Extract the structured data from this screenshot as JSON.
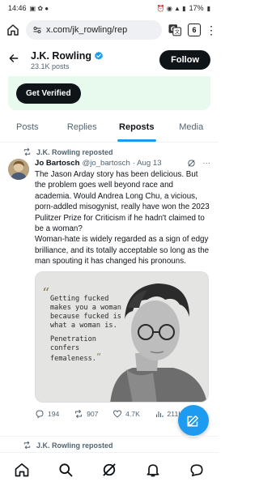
{
  "status_bar": {
    "time": "14:46",
    "battery": "17%"
  },
  "browser": {
    "url": "x.com/jk_rowling/rep",
    "tab_count": "6"
  },
  "profile": {
    "name": "J.K. Rowling",
    "post_count": "23.1K posts",
    "follow_label": "Follow",
    "get_verified_label": "Get Verified"
  },
  "tabs": [
    {
      "label": "Posts"
    },
    {
      "label": "Replies"
    },
    {
      "label": "Reposts"
    },
    {
      "label": "Media"
    }
  ],
  "active_tab": "Reposts",
  "tweet": {
    "repost_label": "J.K. Rowling reposted",
    "author": "Jo Bartosch",
    "handle": "@jo_bartosch",
    "date": "· Aug 13",
    "text": "The Jason Arday story has been delicious. But the problem goes well beyond race and academia. Would Andrea Long Chu, a vicious, porn-addled misogynist, really have won the 2023 Pulitzer Prize for Criticism if he hadn't claimed to be a woman?\nWoman-hate is widely regarded as a sign of edgy brilliance, and its totally acceptable so long as the man spouting it has changed his pronouns.",
    "media_quote": {
      "part1": "Getting fucked makes you a woman because fucked is what a woman is.",
      "part2": "Penetration confers femaleness."
    },
    "stats": {
      "replies": "194",
      "reposts": "907",
      "likes": "4.7K",
      "views": "211K"
    }
  },
  "next_repost_label": "J.K. Rowling reposted",
  "colors": {
    "accent": "#1d9bf0",
    "verified_banner_bg": "#e8f9ee",
    "text_primary": "#0f1419",
    "text_secondary": "#536471"
  }
}
